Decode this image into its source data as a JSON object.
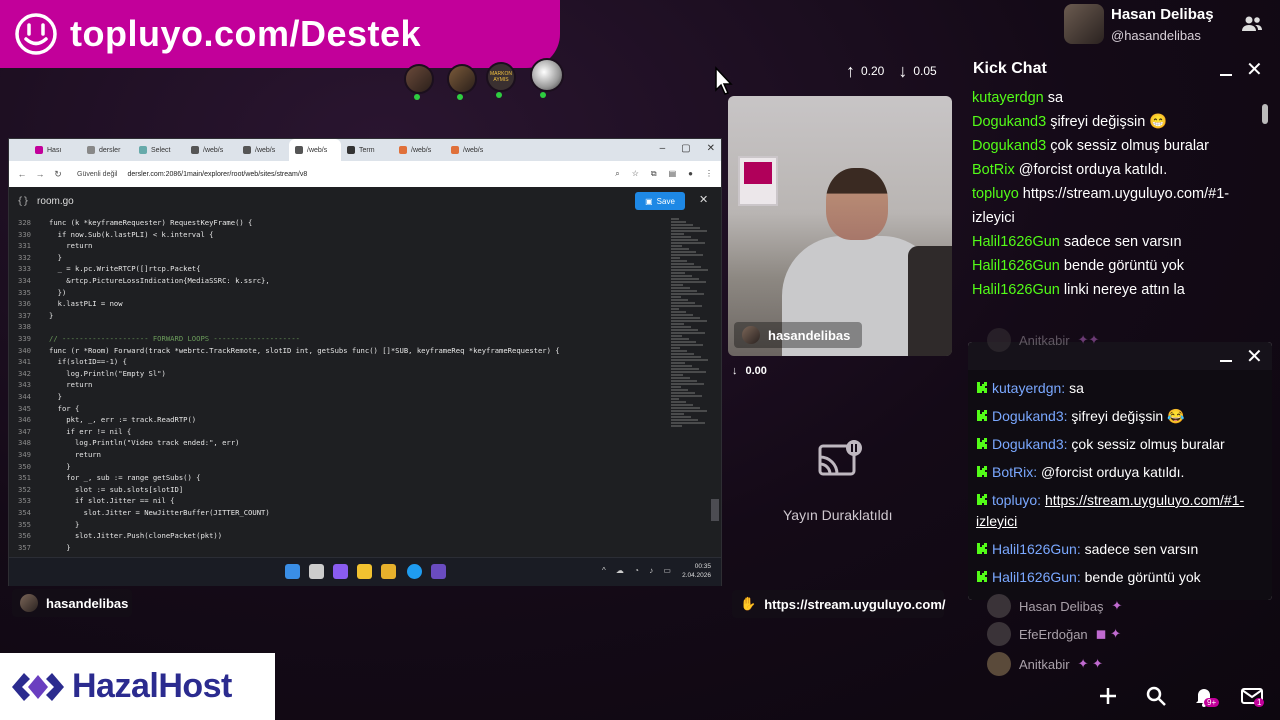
{
  "banner": {
    "text": "topluyo.com/Destek"
  },
  "header_avatars": [
    {
      "name": "guest-avatar-1",
      "label": ""
    },
    {
      "name": "guest-avatar-2",
      "label": ""
    },
    {
      "name": "guest-avatar-3",
      "label": "MARKON AYMIS"
    },
    {
      "name": "guest-avatar-4",
      "label": ""
    }
  ],
  "user": {
    "name": "Hasan Delibaş",
    "handle": "@hasandelibas"
  },
  "stats": {
    "up": "0.20",
    "down": "0.05",
    "audio": "0.00"
  },
  "browser": {
    "tabs": [
      "Hası",
      "dersler",
      "Select",
      "/web/s",
      "/web/s",
      "/web/s",
      "Term",
      "/web/s",
      "/web/s"
    ],
    "security": "Güvenli değil",
    "url": "dersler.com:2086/1main/explorer/root/web/sites/stream/v8"
  },
  "editor": {
    "filename": "room.go",
    "save_label": "Save",
    "lines": [
      {
        "n": "328",
        "t": "func (k *keyframeRequester) RequestKeyFrame() {"
      },
      {
        "n": "330",
        "t": "  if now.Sub(k.lastPLI) < k.interval {"
      },
      {
        "n": "331",
        "t": "    return"
      },
      {
        "n": "332",
        "t": "  }"
      },
      {
        "n": "333",
        "t": "  _ = k.pc.WriteRTCP([]rtcp.Packet{"
      },
      {
        "n": "334",
        "t": "    &rtcp.PictureLossIndication{MediaSSRC: k.ssrc},"
      },
      {
        "n": "335",
        "t": "  })"
      },
      {
        "n": "336",
        "t": "  k.lastPLI = now"
      },
      {
        "n": "337",
        "t": "}"
      },
      {
        "n": "338",
        "t": ""
      },
      {
        "n": "339",
        "t": "// -------------------- FORWARD LOOPS --------------------"
      },
      {
        "n": "340",
        "t": "func (r *Room) Forward(track *webrtc.TrackRemote, slotID int, getSubs func() []*SUB, keyframeReq *keyframeRequester) {"
      },
      {
        "n": "341",
        "t": "  if(slotID==-1) {"
      },
      {
        "n": "342",
        "t": "    log.Println(\"Empty Sl\")"
      },
      {
        "n": "343",
        "t": "    return"
      },
      {
        "n": "344",
        "t": "  }"
      },
      {
        "n": "345",
        "t": "  for {"
      },
      {
        "n": "346",
        "t": "    pkt, _, err := track.ReadRTP()"
      },
      {
        "n": "347",
        "t": "    if err != nil {"
      },
      {
        "n": "348",
        "t": "      log.Println(\"Video track ended:\", err)"
      },
      {
        "n": "349",
        "t": "      return"
      },
      {
        "n": "350",
        "t": "    }"
      },
      {
        "n": "351",
        "t": "    for _, sub := range getSubs() {"
      },
      {
        "n": "352",
        "t": "      slot := sub.slots[slotID]"
      },
      {
        "n": "353",
        "t": "      if slot.Jitter == nil {"
      },
      {
        "n": "354",
        "t": "        slot.Jitter = NewJitterBuffer(JITTER_COUNT)"
      },
      {
        "n": "355",
        "t": "      }"
      },
      {
        "n": "356",
        "t": "      slot.Jitter.Push(clonePacket(pkt))"
      },
      {
        "n": "357",
        "t": "    }"
      }
    ]
  },
  "taskbar": {
    "time": "00:35",
    "date": "2.04.2026"
  },
  "nametag_screen": "hasandelibas",
  "nametag_cam": "hasandelibas",
  "paused": {
    "text": "Yayın Duraklatıldı"
  },
  "stream_url": "https://stream.uyguluyo.com/",
  "kick_chat": {
    "title": "Kick Chat",
    "messages": [
      {
        "user": "kutayerdgn",
        "text": "sa"
      },
      {
        "user": "Dogukand3",
        "text": "şifreyi değişsin 😁"
      },
      {
        "user": "Dogukand3",
        "text": "çok sessiz olmuş buralar"
      },
      {
        "user": "BotRix",
        "text": "@forcist orduya katıldı."
      },
      {
        "user": "topluyo",
        "text": "https://stream.uyguluyo.com/#1-izleyici"
      },
      {
        "user": "Halil1626Gun",
        "text": "sadece sen varsın"
      },
      {
        "user": "Halil1626Gun",
        "text": "bende görüntü yok"
      },
      {
        "user": "Halil1626Gun",
        "text": "linki nereye attın la"
      }
    ]
  },
  "chat2": {
    "messages": [
      {
        "user": "kutayerdgn",
        "text": "sa"
      },
      {
        "user": "Dogukand3",
        "text": "şifreyi değişsin 😂"
      },
      {
        "user": "Dogukand3",
        "text": "çok sessiz olmuş buralar"
      },
      {
        "user": "BotRix",
        "text": "@forcist orduya katıldı."
      },
      {
        "user": "topluyo",
        "text": "https://stream.uyguluyo.com/#1-izleyici"
      },
      {
        "user": "Halil1626Gun",
        "text": "sadece sen varsın"
      },
      {
        "user": "Halil1626Gun",
        "text": "bende görüntü yok"
      }
    ]
  },
  "viewers": [
    {
      "name": "Anitkabir"
    },
    {
      "name": "Hasan Delibaş"
    },
    {
      "name": "EfeErdoğan"
    },
    {
      "name": "Anitkabir"
    }
  ],
  "badges": {
    "notifications": "9+",
    "messages": "1"
  },
  "sponsor": {
    "text": "HazalHost"
  },
  "colors": {
    "banner": "#c2009a",
    "kick_green": "#53fc18",
    "save_blue": "#1e88e5"
  }
}
